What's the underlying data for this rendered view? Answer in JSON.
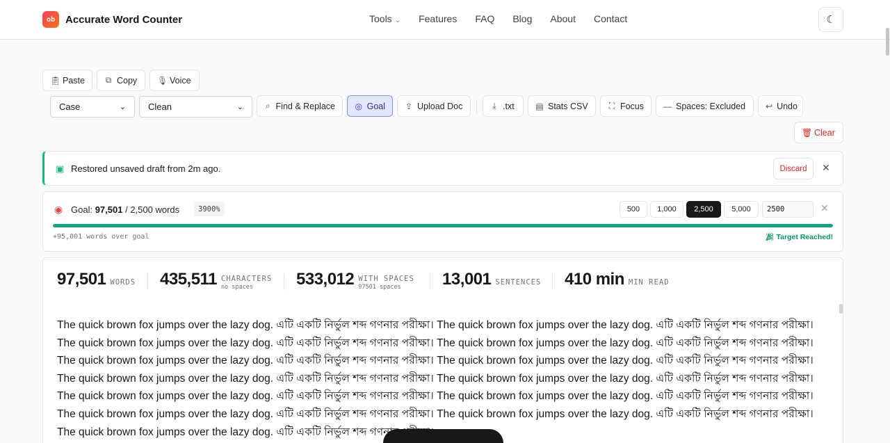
{
  "brand": {
    "logo_text": "ob",
    "name": "Accurate Word Counter"
  },
  "nav": {
    "tools": "Tools",
    "features": "Features",
    "faq": "FAQ",
    "blog": "Blog",
    "about": "About",
    "contact": "Contact"
  },
  "toolbar": {
    "paste": "Paste",
    "copy": "Copy",
    "voice": "Voice",
    "case_select": "Case",
    "clean_select": "Clean",
    "find_replace": "Find & Replace",
    "goal": "Goal",
    "upload_doc": "Upload Doc",
    "txt": ".txt",
    "stats_csv": "Stats CSV",
    "focus": "Focus",
    "spaces": "Spaces: Excluded",
    "undo": "Undo",
    "clear": "Clear"
  },
  "draft": {
    "message": "Restored unsaved draft from 2m ago.",
    "discard": "Discard"
  },
  "goal": {
    "label": "Goal:",
    "current": "97,501",
    "separator": "/",
    "target": "2,500 words",
    "percent": "3900%",
    "progress_fraction": 1.0,
    "presets": [
      "500",
      "1,000",
      "2,500",
      "5,000"
    ],
    "active_preset_index": 2,
    "input_value": "2500",
    "over_text": "+95,001 words over goal",
    "reached_text": "Target Reached!"
  },
  "stats": {
    "words": {
      "value": "97,501",
      "label": "WORDS"
    },
    "characters": {
      "value": "435,511",
      "label": "CHARACTERS",
      "sub": "no spaces"
    },
    "with_spaces": {
      "value": "533,012",
      "label": "WITH SPACES",
      "sub": "97501 spaces"
    },
    "sentences": {
      "value": "13,001",
      "label": "SENTENCES"
    },
    "read": {
      "value": "410 min",
      "label": "MIN READ"
    }
  },
  "editor": {
    "text": "The quick brown fox jumps over the lazy dog. এটি একটি নির্ভুল শব্দ গণনার পরীক্ষা। The quick brown fox jumps over the lazy dog. এটি একটি নির্ভুল শব্দ গণনার পরীক্ষা। The quick brown fox jumps over the lazy dog. এটি একটি নির্ভুল শব্দ গণনার পরীক্ষা। The quick brown fox jumps over the lazy dog. এটি একটি নির্ভুল শব্দ গণনার পরীক্ষা। The quick brown fox jumps over the lazy dog. এটি একটি নির্ভুল শব্দ গণনার পরীক্ষা। The quick brown fox jumps over the lazy dog. এটি একটি নির্ভুল শব্দ গণনার পরীক্ষা। The quick brown fox jumps over the lazy dog. এটি একটি নির্ভুল শব্দ গণনার পরীক্ষা। The quick brown fox jumps over the lazy dog. এটি একটি নির্ভুল শব্দ গণনার পরীক্ষা। The quick brown fox jumps over the lazy dog. এটি একটি নির্ভুল শব্দ গণনার পরীক্ষা। The quick brown fox jumps over the lazy dog. এটি একটি নির্ভুল শব্দ গণনার পরীক্ষা। The quick brown fox jumps over the lazy dog. এটি একটি নির্ভুল শব্দ গণনার পরীক্ষা। The quick brown fox jumps over the lazy dog. এটি একটি নির্ভুল শব্দ গণনার পরীক্ষা। The quick brown fox jumps over the lazy dog. এটি একটি নির্ভুল শব্দ গণনার পরীক্ষা।"
  },
  "colors": {
    "accent": "#10a37f",
    "goal_active": "#e0e7ff",
    "danger": "#dc2626"
  }
}
